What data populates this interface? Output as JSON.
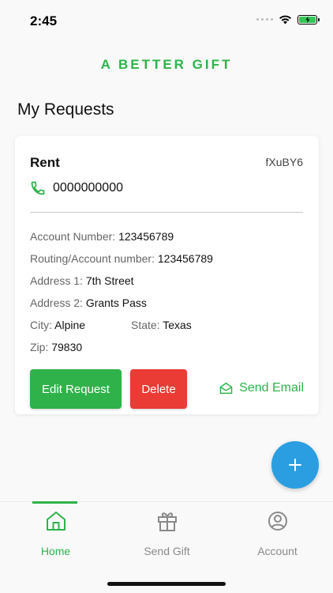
{
  "status_bar": {
    "time": "2:45"
  },
  "brand": {
    "title": "A BETTER GIFT"
  },
  "page": {
    "title": "My Requests"
  },
  "request": {
    "title": "Rent",
    "code": "fXuBY6",
    "phone": "0000000000",
    "fields": {
      "account_number": {
        "label": "Account Number: ",
        "value": "123456789"
      },
      "routing_number": {
        "label": "Routing/Account number: ",
        "value": "123456789"
      },
      "address1": {
        "label": "Address 1: ",
        "value": "7th Street"
      },
      "address2": {
        "label": "Address 2: ",
        "value": "Grants Pass"
      },
      "city": {
        "label": "City: ",
        "value": "Alpine"
      },
      "state": {
        "label": "State: ",
        "value": "Texas"
      },
      "zip": {
        "label": "Zip: ",
        "value": "79830"
      }
    },
    "actions": {
      "edit_label": "Edit Request",
      "delete_label": "Delete",
      "email_label": "Send Email"
    }
  },
  "tabs": [
    {
      "label": "Home",
      "icon": "home-icon",
      "active": true
    },
    {
      "label": "Send Gift",
      "icon": "gift-icon",
      "active": false
    },
    {
      "label": "Account",
      "icon": "account-icon",
      "active": false
    }
  ],
  "colors": {
    "brand_green": "#2db34a",
    "delete_red": "#ea3b35",
    "fab_blue": "#2a9ee0",
    "inactive_tab": "#8a8a8a"
  }
}
